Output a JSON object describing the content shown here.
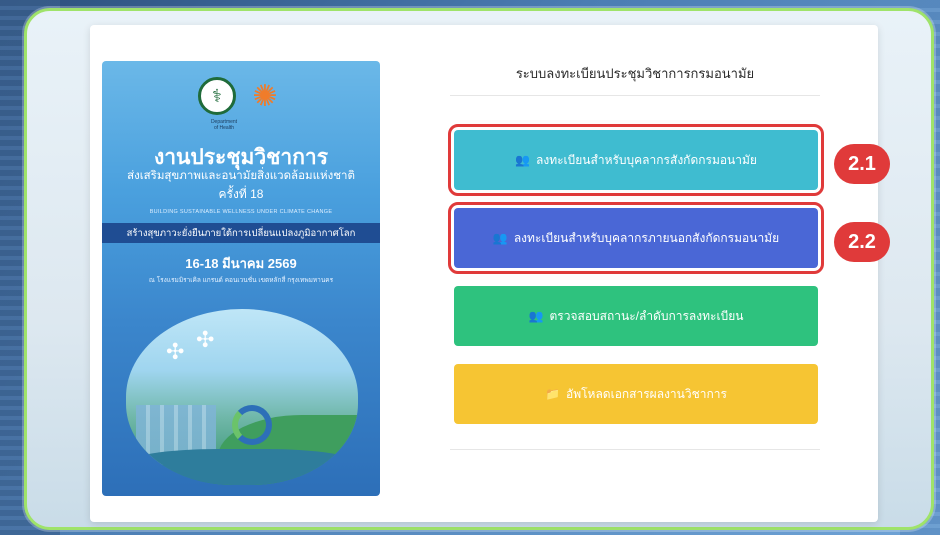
{
  "colors": {
    "frame_border": "#9fe36a",
    "btn_internal": "#3fbcd0",
    "btn_external": "#4a67d6",
    "btn_status": "#2ec27e",
    "btn_upload": "#f6c533",
    "highlight": "#e03a3a"
  },
  "poster": {
    "department": "Department of Health",
    "title": "งานประชุมวิชาการ",
    "subtitle1": "ส่งเสริมสุขภาพและอนามัยสิ่งแวดล้อมแห่งชาติ",
    "subtitle2": "ครั้งที่ 18",
    "english": "BUILDING SUSTAINABLE WELLNESS UNDER CLIMATE CHANGE",
    "band": "สร้างสุขภาวะยั่งยืนภายใต้การเปลี่ยนแปลงภูมิอากาศโลก",
    "date": "16-18 มีนาคม 2569",
    "venue": "ณ โรงแรมมิราเคิล แกรนด์ คอนเวนชั่น เขตหลักสี่ กรุงเทพมหานคร"
  },
  "panel": {
    "title": "ระบบลงทะเบียนประชุมวิชาการกรมอนามัย",
    "buttons": {
      "internal": {
        "icon": "users-icon",
        "label": "ลงทะเบียนสำหรับบุคลากรสังกัดกรมอนามัย"
      },
      "external": {
        "icon": "users-icon",
        "label": "ลงทะเบียนสำหรับบุคลากรภายนอกสังกัดกรมอนามัย"
      },
      "status": {
        "icon": "users-icon",
        "label": "ตรวจสอบสถานะ/ลำดับการลงทะเบียน"
      },
      "upload": {
        "icon": "folder-icon",
        "label": "อัพโหลดเอกสารผลงานวิชาการ"
      }
    }
  },
  "annotations": {
    "badge1": "2.1",
    "badge2": "2.2"
  }
}
